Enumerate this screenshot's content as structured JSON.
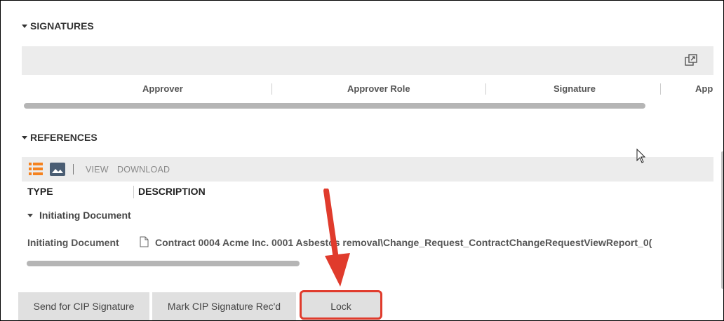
{
  "signatures": {
    "title": "SIGNATURES",
    "columns": [
      "Approver",
      "Approver Role",
      "Signature",
      "App"
    ]
  },
  "references": {
    "title": "REFERENCES",
    "toolbar": {
      "view_label": "VIEW",
      "download_label": "DOWNLOAD"
    },
    "columns": {
      "type": "TYPE",
      "description": "DESCRIPTION"
    },
    "group": "Initiating Document",
    "row": {
      "type": "Initiating Document",
      "description": "Contract 0004 Acme Inc. 0001 Asbestos removal\\Change_Request_ContractChangeRequestViewReport_0("
    }
  },
  "actions": {
    "send_cip": "Send for CIP Signature",
    "mark_cip": "Mark CIP Signature Rec'd",
    "lock": "Lock"
  },
  "colors": {
    "highlight": "#e03b2c",
    "list_icon": "#f5821f",
    "image_icon": "#4a5d73"
  },
  "icons": [
    "chevron-down-icon",
    "popout-icon",
    "list-view-icon",
    "image-view-icon",
    "file-icon",
    "mouse-cursor-icon",
    "annotation-arrow"
  ]
}
